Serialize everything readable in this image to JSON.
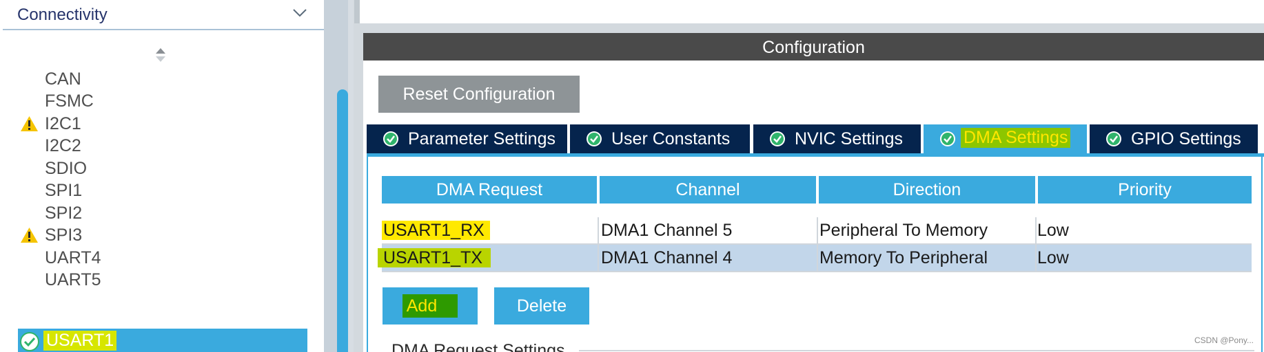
{
  "sidebar": {
    "category": "Connectivity",
    "items": [
      {
        "label": "CAN",
        "warning": false
      },
      {
        "label": "FSMC",
        "warning": false
      },
      {
        "label": "I2C1",
        "warning": true
      },
      {
        "label": "I2C2",
        "warning": false
      },
      {
        "label": "SDIO",
        "warning": false
      },
      {
        "label": "SPI1",
        "warning": false
      },
      {
        "label": "SPI2",
        "warning": false
      },
      {
        "label": "SPI3",
        "warning": true
      },
      {
        "label": "UART4",
        "warning": false
      },
      {
        "label": "UART5",
        "warning": false
      },
      {
        "label": "USART1",
        "selected": true,
        "ok": true
      }
    ]
  },
  "config": {
    "title": "Configuration",
    "reset_label": "Reset Configuration",
    "tabs": [
      {
        "label": "Parameter Settings"
      },
      {
        "label": "User Constants"
      },
      {
        "label": "NVIC Settings"
      },
      {
        "label": "DMA Settings",
        "active": true
      },
      {
        "label": "GPIO Settings"
      }
    ]
  },
  "dma": {
    "columns": [
      "DMA Request",
      "Channel",
      "Direction",
      "Priority"
    ],
    "rows": [
      {
        "request": "USART1_RX",
        "channel": "DMA1 Channel 5",
        "direction": "Peripheral To Memory",
        "priority": "Low"
      },
      {
        "request": "USART1_TX",
        "channel": "DMA1 Channel 4",
        "direction": "Memory To Peripheral",
        "priority": "Low"
      }
    ],
    "add_label": "Add",
    "delete_label": "Delete",
    "section_title": "DMA Request Settings"
  },
  "watermark": "CSDN @Pony...",
  "colors": {
    "accent": "#3aaade",
    "tab_dark": "#05244d",
    "warning": "#f5c400",
    "ok": "#2fb46b"
  }
}
